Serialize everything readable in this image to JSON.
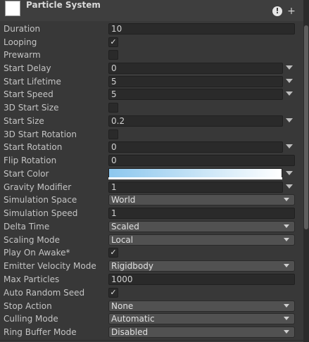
{
  "header": {
    "title": "Particle System",
    "warning_glyph": "!",
    "add_glyph": "+"
  },
  "rows": {
    "duration": {
      "label": "Duration",
      "value": "10"
    },
    "looping": {
      "label": "Looping",
      "checked": true
    },
    "prewarm": {
      "label": "Prewarm",
      "checked": false
    },
    "start_delay": {
      "label": "Start Delay",
      "value": "0"
    },
    "start_lifetime": {
      "label": "Start Lifetime",
      "value": "5"
    },
    "start_speed": {
      "label": "Start Speed",
      "value": "5"
    },
    "start_size_3d": {
      "label": "3D Start Size",
      "checked": false
    },
    "start_size": {
      "label": "Start Size",
      "value": "0.2"
    },
    "start_rotation_3d": {
      "label": "3D Start Rotation",
      "checked": false
    },
    "start_rotation": {
      "label": "Start Rotation",
      "value": "0"
    },
    "flip_rotation": {
      "label": "Flip Rotation",
      "value": "0"
    },
    "start_color": {
      "label": "Start Color",
      "color_from": "#8cc7ee",
      "color_to": "#ffffff"
    },
    "gravity_modifier": {
      "label": "Gravity Modifier",
      "value": "1"
    },
    "simulation_space": {
      "label": "Simulation Space",
      "value": "World"
    },
    "simulation_speed": {
      "label": "Simulation Speed",
      "value": "1"
    },
    "delta_time": {
      "label": "Delta Time",
      "value": "Scaled"
    },
    "scaling_mode": {
      "label": "Scaling Mode",
      "value": "Local"
    },
    "play_on_awake": {
      "label": "Play On Awake*",
      "checked": true
    },
    "emitter_velocity_mode": {
      "label": "Emitter Velocity Mode",
      "value": "Rigidbody"
    },
    "max_particles": {
      "label": "Max Particles",
      "value": "1000"
    },
    "auto_random_seed": {
      "label": "Auto Random Seed",
      "checked": true
    },
    "stop_action": {
      "label": "Stop Action",
      "value": "None"
    },
    "culling_mode": {
      "label": "Culling Mode",
      "value": "Automatic"
    },
    "ring_buffer_mode": {
      "label": "Ring Buffer Mode",
      "value": "Disabled"
    }
  },
  "checkmark_glyph": "✓"
}
